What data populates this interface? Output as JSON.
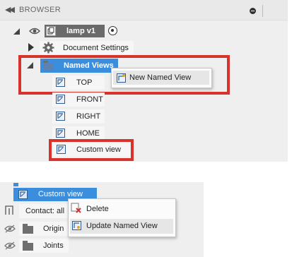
{
  "browser": {
    "collapse_icon": "double-left-arrow-icon",
    "title": "BROWSER"
  },
  "tree": {
    "component": "lamp v1",
    "document_settings": "Document Settings",
    "named_views": "Named Views",
    "views": [
      "TOP",
      "FRONT",
      "RIGHT",
      "HOME",
      "Custom view"
    ]
  },
  "context_menu_1": {
    "item": "New Named View"
  },
  "bottom": {
    "selected_item": "Custom view",
    "contact": "Contact: all",
    "origin": "Origin",
    "joints": "Joints"
  },
  "context_menu_2": {
    "items": [
      "Delete",
      "Update Named View"
    ]
  },
  "colors": {
    "selection": "#3b8ede",
    "highlight_box": "#d8322c",
    "panel_bg": "#efefef"
  }
}
